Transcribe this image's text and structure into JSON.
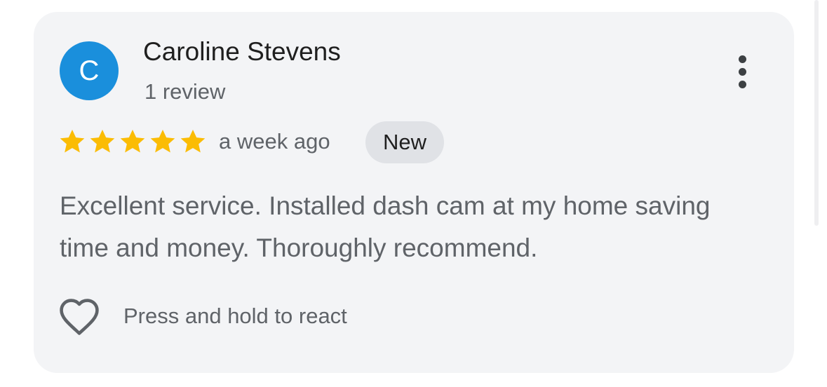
{
  "review": {
    "avatar_letter": "C",
    "avatar_color": "#1a8fdc",
    "reviewer_name": "Caroline Stevens",
    "review_count": "1 review",
    "rating": 5,
    "rating_max": 5,
    "star_color": "#fbbc04",
    "time_ago": "a week ago",
    "badge": "New",
    "text": "Excellent service. Installed dash cam at my home saving time and money. Thoroughly recommend.",
    "react_label": "Press and hold to react",
    "icons": {
      "more": "more-vertical-icon",
      "react": "heart-outline-icon",
      "star": "star-icon"
    }
  }
}
